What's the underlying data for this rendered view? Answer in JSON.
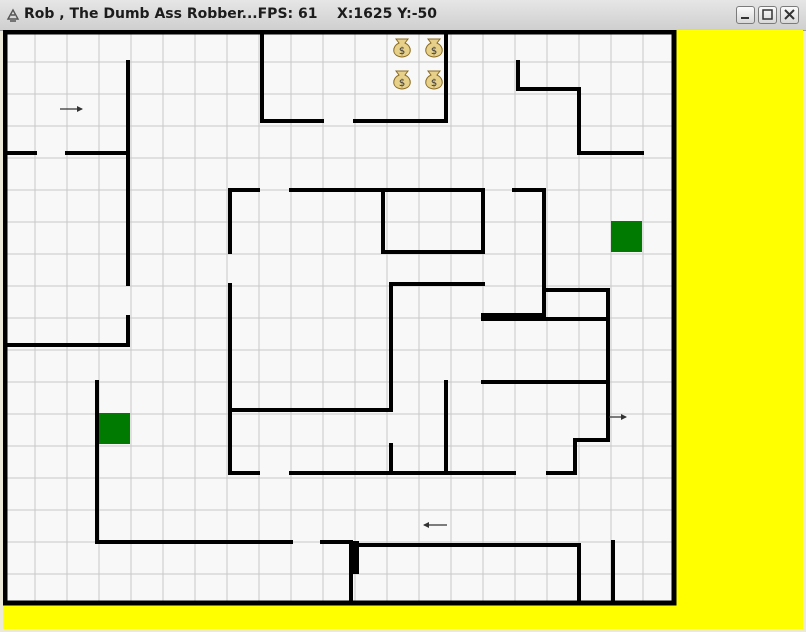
{
  "window": {
    "title": "Rob , The Dumb Ass Robber...FPS: 61    X:1625 Y:-50",
    "buttons": {
      "minimize": "minimize",
      "maximize": "maximize",
      "close": "close"
    }
  },
  "colors": {
    "background": "#ffff00",
    "floor": "#f8f8f8",
    "grid_line": "#c8c8c8",
    "wall": "#000000",
    "goal_tile": "#007a00",
    "money_bag": "#e6d08a",
    "arrow": "#333333"
  },
  "icons": {
    "app": "robber-icon",
    "money": "money-bag-icon",
    "guard": "arrow-icon",
    "goal": "green-tile"
  },
  "game": {
    "money_bags": 4,
    "goal_tiles": 2,
    "guard_arrows": [
      "right",
      "right",
      "left"
    ]
  }
}
